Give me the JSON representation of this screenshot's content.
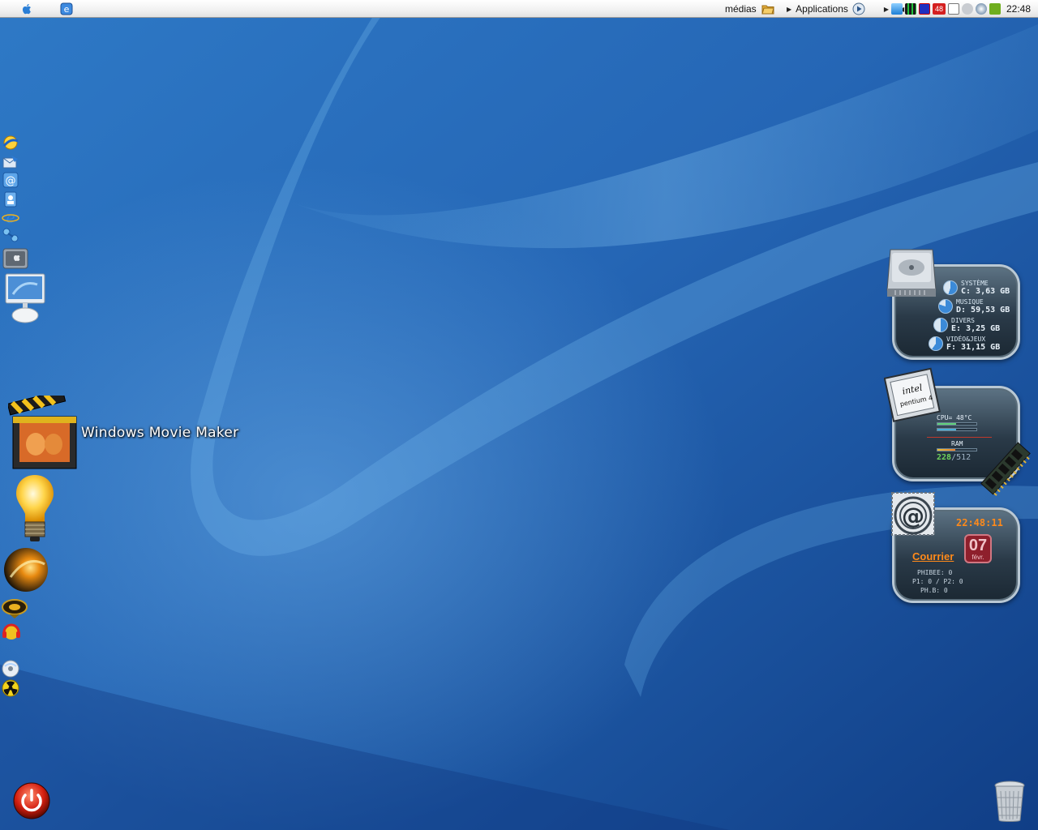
{
  "menubar": {
    "medias_label": "médias",
    "applications_label": "Applications",
    "tray_temp_badge": "48",
    "clock": "22:48"
  },
  "dock": {
    "icons": [
      "aim-icon",
      "mail-icon",
      "email-at-icon",
      "address-book-icon",
      "internet-explorer-icon",
      "network-icon",
      "mac-hard-disk-icon",
      "imac-icon",
      "movie-maker-icon",
      "lightbulb-icon",
      "orb-icon",
      "speaker-icon",
      "headphones-icon",
      "cd-icon",
      "radiation-icon",
      "power-icon"
    ],
    "movie_maker_label": "Windows Movie Maker"
  },
  "widgets": {
    "drives": {
      "items": [
        {
          "name": "SYSTÈME",
          "size": "C: 3,63 GB",
          "fill": 0.55
        },
        {
          "name": "MUSIQUE",
          "size": "D: 59,53 GB",
          "fill": 0.8
        },
        {
          "name": "DIVERS",
          "size": "E: 3,25 GB",
          "fill": 0.5
        },
        {
          "name": "VIDÉO&JEUX",
          "size": "F: 31,15 GB",
          "fill": 0.6
        }
      ]
    },
    "cpu": {
      "cpu_label": "CPU= 48°C",
      "ram_label": "RAM",
      "ram_used": "228",
      "ram_total": "/512",
      "cpu_fraction": 0.48,
      "ram_fraction": 0.45
    },
    "mail": {
      "time": "22:48:11",
      "day": "07",
      "month": "févr.",
      "courrier_label": "Courrier",
      "lines": [
        "PHIBEE: 0",
        "P1: 0 / P2: 0",
        "PH.B: 0"
      ]
    }
  },
  "colors": {
    "wallpaper_base": "#1f63b3",
    "accent_orange": "#ff8a1a",
    "ram_green": "#68d05a"
  }
}
